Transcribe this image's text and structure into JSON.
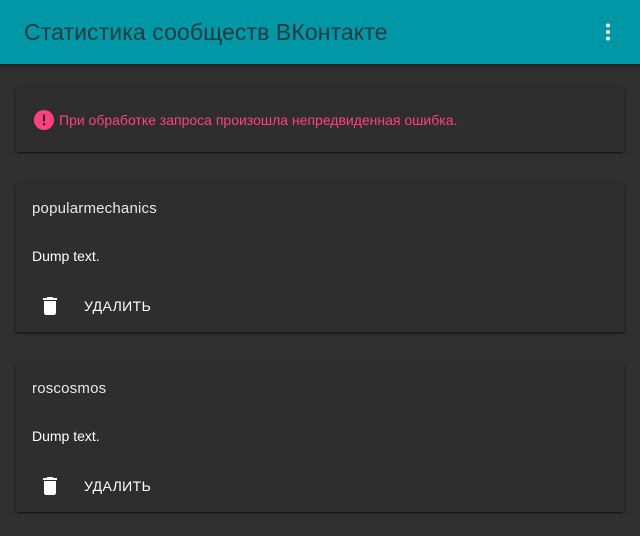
{
  "appbar": {
    "title": "Статистика сообществ ВКонтакте",
    "menu_icon": "more-vert-icon",
    "background": "#0097a7"
  },
  "error": {
    "icon": "error-icon",
    "message": "При обработке запроса произошла непредвиденная ошибка.",
    "color": "#ff4081"
  },
  "communities": [
    {
      "name": "popularmechanics",
      "text": "Dump text.",
      "delete_label": "УДАЛИТЬ",
      "delete_icon": "trash-icon"
    },
    {
      "name": "roscosmos",
      "text": "Dump text.",
      "delete_label": "УДАЛИТЬ",
      "delete_icon": "trash-icon"
    }
  ]
}
